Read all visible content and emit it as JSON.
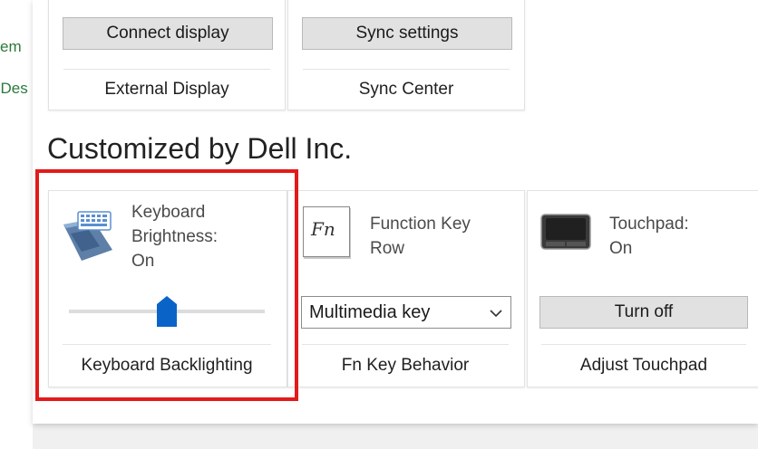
{
  "left_sidebar": {
    "link1": "em",
    "link2": "l Des"
  },
  "top_tiles": [
    {
      "button_label": "Connect display",
      "footer_label": "External Display"
    },
    {
      "button_label": "Sync settings",
      "footer_label": "Sync Center"
    }
  ],
  "section": {
    "title": "Customized by Dell Inc."
  },
  "keyboard_tile": {
    "status_line1": "Keyboard",
    "status_line2": "Brightness:",
    "status_line3": "On",
    "slider_value_percent": 50,
    "footer_label": "Keyboard Backlighting",
    "icon": "keyboard-backlight-icon"
  },
  "fn_tile": {
    "icon_text": "Fn",
    "title_line1": "Function Key",
    "title_line2": "Row",
    "selected_option": "Multimedia key",
    "footer_label": "Fn Key Behavior",
    "icon": "fn-key-icon"
  },
  "touchpad_tile": {
    "title_line1": "Touchpad:",
    "title_line2": "On",
    "button_label": "Turn off",
    "footer_label": "Adjust Touchpad",
    "icon": "touchpad-icon"
  },
  "colors": {
    "highlight": "#e21a1a",
    "slider_thumb": "#0a64c8",
    "link_green": "#2a7a3a"
  }
}
